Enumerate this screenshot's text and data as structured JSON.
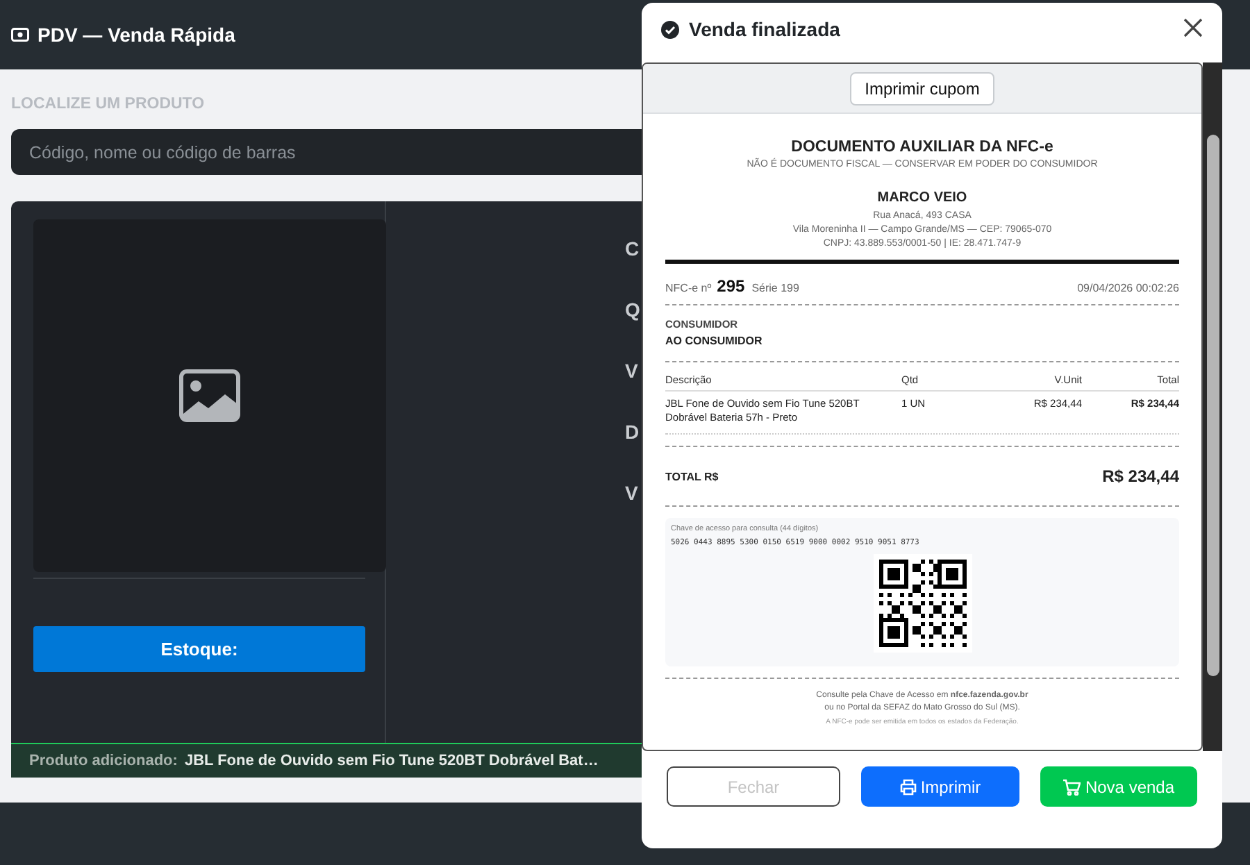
{
  "app_header": {
    "title": "PDV — Venda Rápida"
  },
  "search": {
    "label": "LOCALIZE UM PRODUTO",
    "placeholder": "Código, nome ou código de barras"
  },
  "product_panel": {
    "stock_button": "Estoque:",
    "field_labels": [
      "C",
      "Q",
      "V",
      "D",
      "V"
    ],
    "added_banner": {
      "label": "Produto adicionado:",
      "product": "JBL Fone de Ouvido sem Fio Tune 520BT Dobrável Bat…"
    }
  },
  "modal": {
    "title": "Venda finalizada",
    "receipt_toolbar": {
      "button": "Imprimir cupom"
    },
    "receipt": {
      "title": "DOCUMENTO AUXILIAR DA NFC-e",
      "subtitle": "NÃO É DOCUMENTO FISCAL — CONSERVAR EM PODER DO CONSUMIDOR",
      "company": "MARCO VEIO",
      "address_lines": [
        "Rua Anacá, 493 CASA",
        "Vila Moreninha II — Campo Grande/MS — CEP: 79065-070",
        "CNPJ: 43.889.553/0001-50 | IE: 28.471.747-9"
      ],
      "number_label": "NFC-e nº",
      "number": "295",
      "series": "Série 199",
      "datetime": "09/04/2026 00:02:26",
      "consumer_label": "CONSUMIDOR",
      "consumer": "AO CONSUMIDOR",
      "columns": [
        "Descrição",
        "Qtd",
        "V.Unit",
        "Total"
      ],
      "items": [
        {
          "description": "JBL Fone de Ouvido sem Fio Tune 520BT Dobrável Bateria 57h - Preto",
          "qty": "1 UN",
          "unit": "R$ 234,44",
          "total": "R$ 234,44"
        }
      ],
      "total_label": "TOTAL R$",
      "total": "R$ 234,44",
      "access_key_label": "Chave de acesso para consulta (44 dígitos)",
      "access_key": "5026 0443 8895 5300 0150 6519 9000 0002 9510 9051 8773",
      "footer_lines": [
        "Consulte pela Chave de Acesso em **nfce.fazenda.gov.br**",
        "ou no Portal da SEFAZ do Mato Grosso do Sul (MS).",
        "A NFC-e pode ser emitida em todos os estados da Federação."
      ]
    },
    "buttons": [
      {
        "label": "Fechar",
        "kind": "outline",
        "disabled": true
      },
      {
        "label": "Imprimir",
        "kind": "print",
        "disabled": false
      },
      {
        "label": "Nova venda",
        "kind": "cart",
        "disabled": false
      }
    ]
  }
}
